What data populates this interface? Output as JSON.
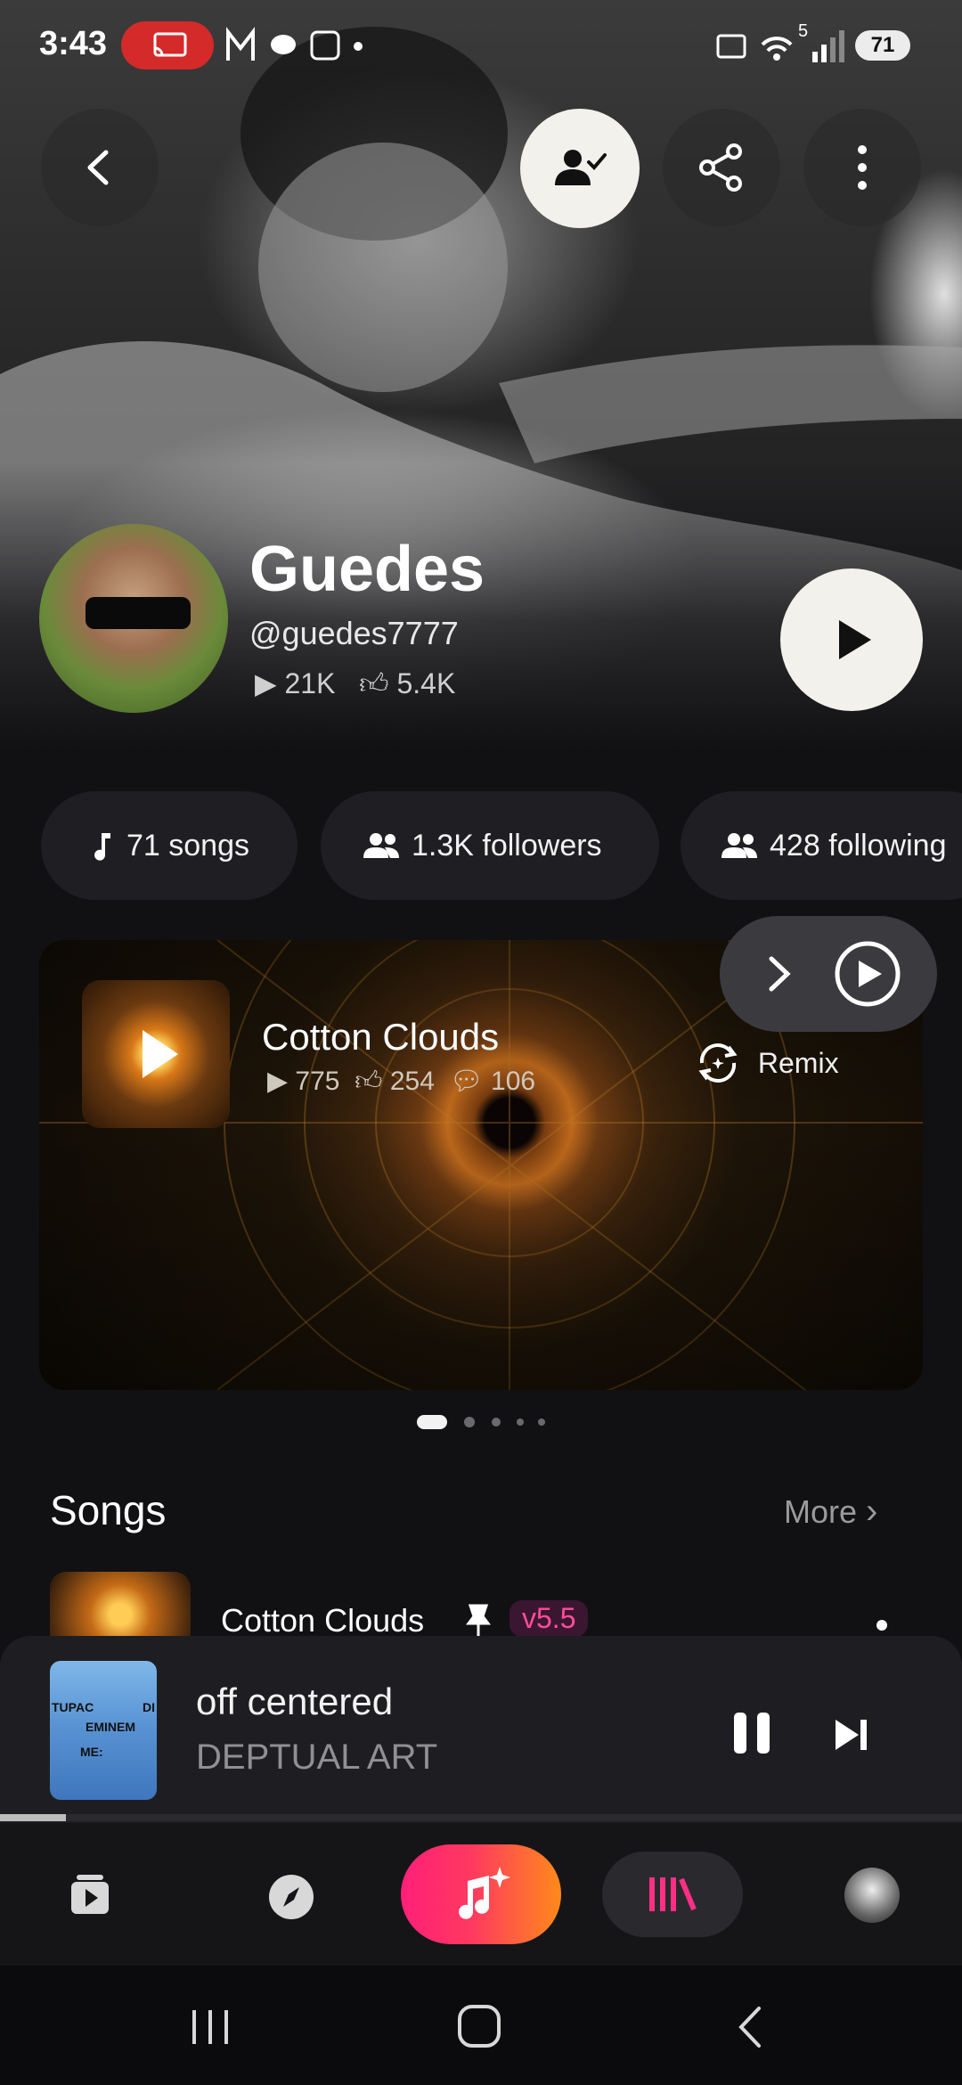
{
  "status_bar": {
    "time": "3:43",
    "battery": "71",
    "left_icons": "M ⋯",
    "signal_label": "5"
  },
  "profile": {
    "name": "Guedes",
    "handle": "@guedes7777",
    "plays": "21K",
    "likes": "5.4K"
  },
  "chips": [
    {
      "label": "71 songs",
      "icon": "music-note-icon"
    },
    {
      "label": "1.3K followers",
      "icon": "people-icon"
    },
    {
      "label": "428 following",
      "icon": "people-icon"
    }
  ],
  "featured": {
    "title": "Cotton Clouds",
    "plays": "775",
    "likes": "254",
    "comments": "106",
    "remix_label": "Remix",
    "carousel_pages": 5,
    "carousel_active": 1
  },
  "songs": {
    "section_title": "Songs",
    "more_label": "More",
    "items": [
      {
        "title": "Cotton Clouds",
        "version": "v5.5",
        "pinned": true
      }
    ]
  },
  "mini_player": {
    "title": "off centered",
    "artist": "DEPTUAL ART",
    "art_text": [
      "TUPAC",
      "EMINEM",
      "ME:",
      "DI"
    ],
    "progress": 0.07
  },
  "colors": {
    "accent_start": "#ff1f78",
    "accent_end": "#ff8a1a",
    "version_badge": "#ff4d9a",
    "cast_pill": "#d42a2a"
  }
}
